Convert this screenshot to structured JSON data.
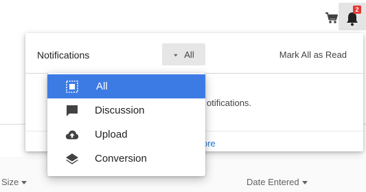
{
  "header": {
    "icons": {
      "cart": "shopping-cart-icon",
      "bell": "bell-icon"
    },
    "notification_count": "2",
    "badge_color": "#e53935"
  },
  "background": {
    "columns": {
      "size": "Size",
      "date_entered": "Date Entered"
    }
  },
  "notifications": {
    "title": "Notifications",
    "filter_selected": "All",
    "mark_all_read": "Mark All as Read",
    "empty_message_fragment": "otifications.",
    "more_link_fragment": "ore"
  },
  "filter_menu": {
    "items": [
      {
        "label": "All",
        "icon": "all-items-icon",
        "selected": true
      },
      {
        "label": "Discussion",
        "icon": "chat-bubble-icon",
        "selected": false
      },
      {
        "label": "Upload",
        "icon": "cloud-upload-icon",
        "selected": false
      },
      {
        "label": "Conversion",
        "icon": "layers-icon",
        "selected": false
      }
    ],
    "selected_color": "#3d7be4"
  },
  "colors": {
    "link": "#1976d2",
    "accent": "#3d7be4"
  }
}
